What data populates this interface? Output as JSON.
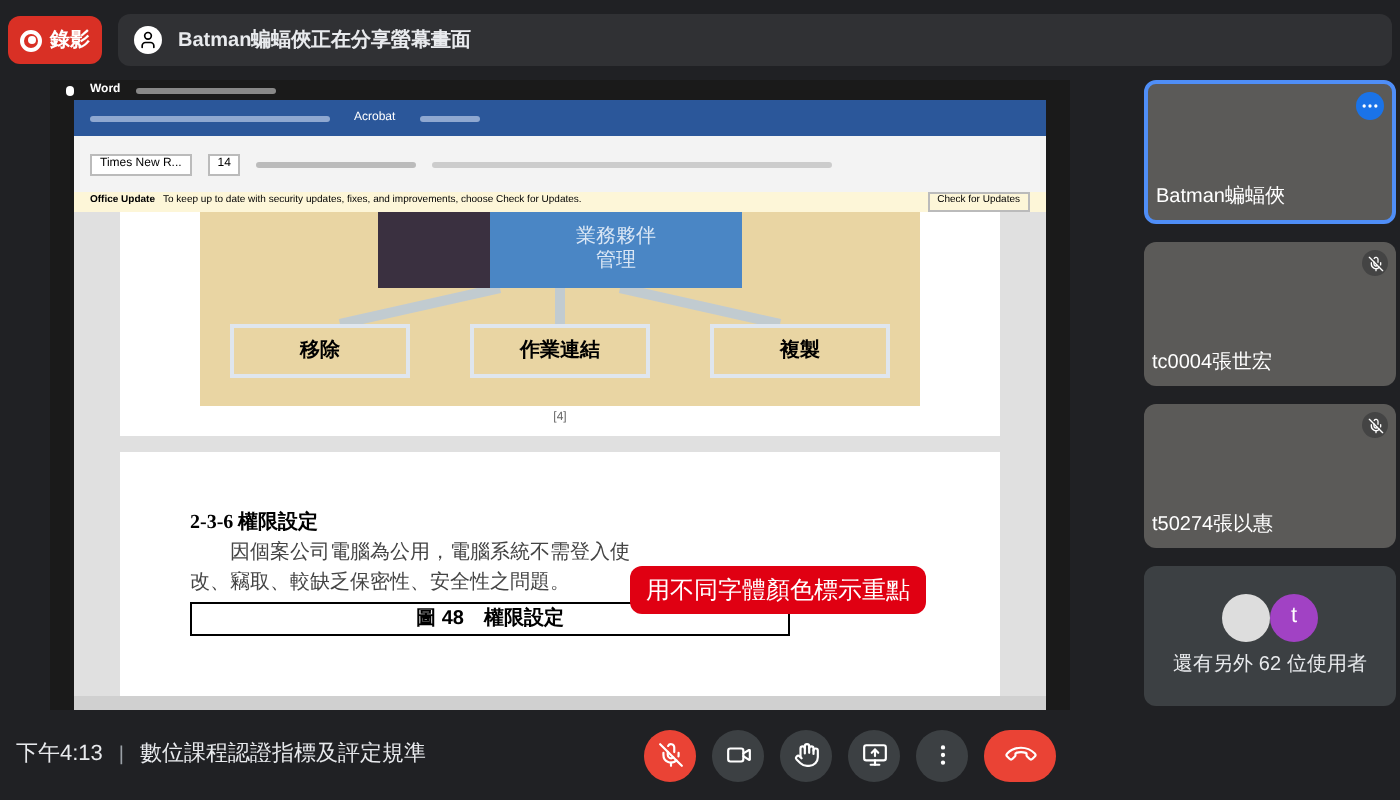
{
  "record_button": {
    "label": "錄影"
  },
  "presenter_banner": {
    "text": "Batman蝙蝠俠正在分享螢幕畫面"
  },
  "shared_screen": {
    "mac_menu": {
      "app": "Word"
    },
    "word": {
      "ribbon_tab": "Acrobat",
      "font_name": "Times New R...",
      "font_size": "14",
      "update_bar": {
        "title": "Office Update",
        "message": "To keep up to date with security updates, fixes, and improvements, choose Check for Updates.",
        "button": "Check for Updates"
      }
    },
    "document": {
      "diagram": {
        "box_lines": [
          "業務夥伴",
          "管理"
        ],
        "labels": [
          "移除",
          "作業連結",
          "複製"
        ]
      },
      "page_number": "[4]",
      "heading": "2-3-6 權限設定",
      "paragraph_lines": [
        "因個案公司電腦為公用，電腦系統不需登入使",
        "改、竊取、較缺乏保密性、安全性之問題。"
      ],
      "figure_caption": "圖 48　權限設定"
    },
    "caption_overlay": "用不同字體顏色標示重點"
  },
  "participants": [
    {
      "name": "Batman蝙蝠俠",
      "speaking": true,
      "muted": false
    },
    {
      "name": "tc0004張世宏",
      "speaking": false,
      "muted": true
    },
    {
      "name": "t50274張以惠",
      "speaking": false,
      "muted": true
    }
  ],
  "others": {
    "avatar_letter": "t",
    "text": "還有另外 62 位使用者"
  },
  "footer": {
    "time": "下午4:13",
    "separator": "|",
    "meeting_title": "數位課程認證指標及評定規準"
  },
  "controls": [
    {
      "kind": "mic",
      "active": true
    },
    {
      "kind": "camera",
      "active": false
    },
    {
      "kind": "hand",
      "active": false
    },
    {
      "kind": "present",
      "active": false
    },
    {
      "kind": "more",
      "active": false
    },
    {
      "kind": "end",
      "active": true
    }
  ]
}
